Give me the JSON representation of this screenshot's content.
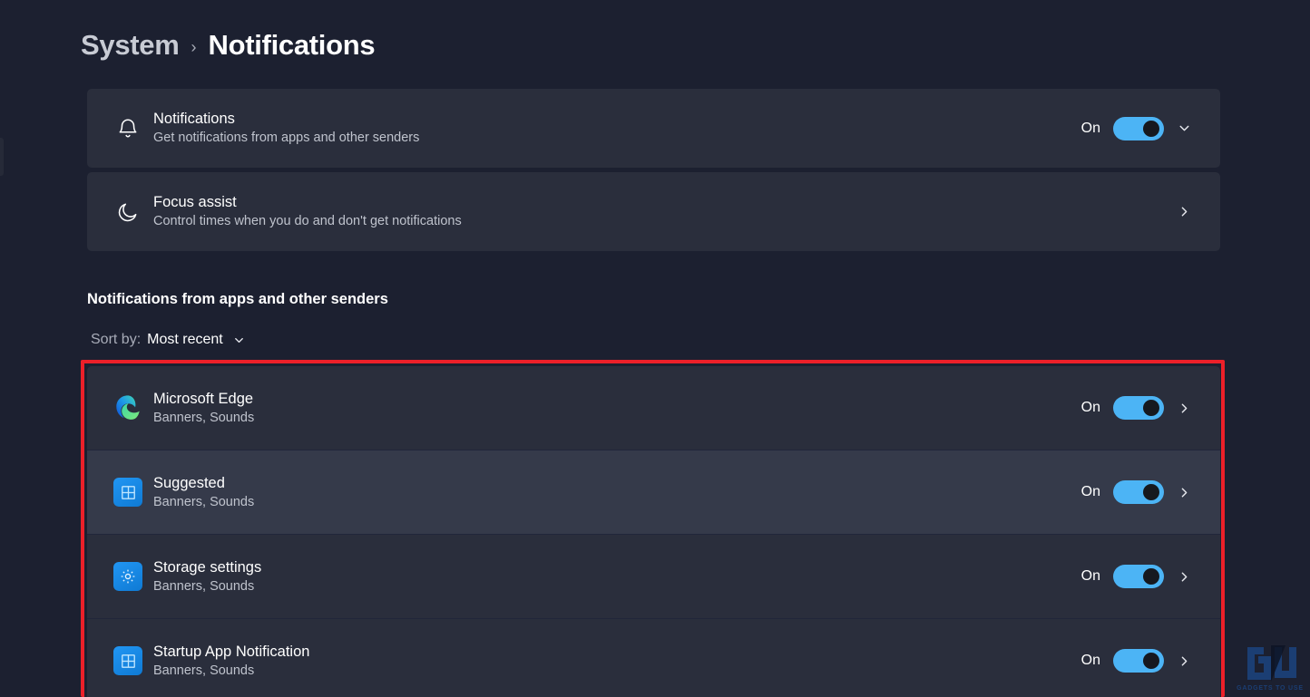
{
  "breadcrumb": {
    "parent": "System",
    "separator": "›",
    "current": "Notifications"
  },
  "settings_cards": [
    {
      "icon": "bell-icon",
      "title": "Notifications",
      "subtitle": "Get notifications from apps and other senders",
      "state_label": "On",
      "toggle_on": true,
      "expander": "chevron-down-icon"
    },
    {
      "icon": "moon-icon",
      "title": "Focus assist",
      "subtitle": "Control times when you do and don't get notifications",
      "state_label": "",
      "toggle_on": false,
      "expander": "chevron-right-icon"
    }
  ],
  "section": {
    "heading": "Notifications from apps and other senders",
    "sort_label": "Sort by:",
    "sort_value": "Most recent",
    "sort_chevron": "chevron-down-icon"
  },
  "apps": [
    {
      "icon": "microsoft-edge-icon",
      "name": "Microsoft Edge",
      "detail": "Banners, Sounds",
      "state_label": "On",
      "toggle_on": true,
      "chevron": "chevron-right-icon",
      "hovered": false
    },
    {
      "icon": "windows-tile-icon",
      "name": "Suggested",
      "detail": "Banners, Sounds",
      "state_label": "On",
      "toggle_on": true,
      "chevron": "chevron-right-icon",
      "hovered": true
    },
    {
      "icon": "storage-settings-icon",
      "name": "Storage settings",
      "detail": "Banners, Sounds",
      "state_label": "On",
      "toggle_on": true,
      "chevron": "chevron-right-icon",
      "hovered": false
    },
    {
      "icon": "windows-tile-icon",
      "name": "Startup App Notification",
      "detail": "Banners, Sounds",
      "state_label": "On",
      "toggle_on": true,
      "chevron": "chevron-right-icon",
      "hovered": false
    }
  ],
  "watermark": {
    "text": "GADGETS TO USE"
  },
  "colors": {
    "page_background": "#1c2030",
    "card_background": "#2a2e3c",
    "row_hover_background": "#353a4a",
    "toggle_accent": "#4cb4f5",
    "highlight_border": "#ec2029",
    "watermark": "#1b3e73"
  }
}
